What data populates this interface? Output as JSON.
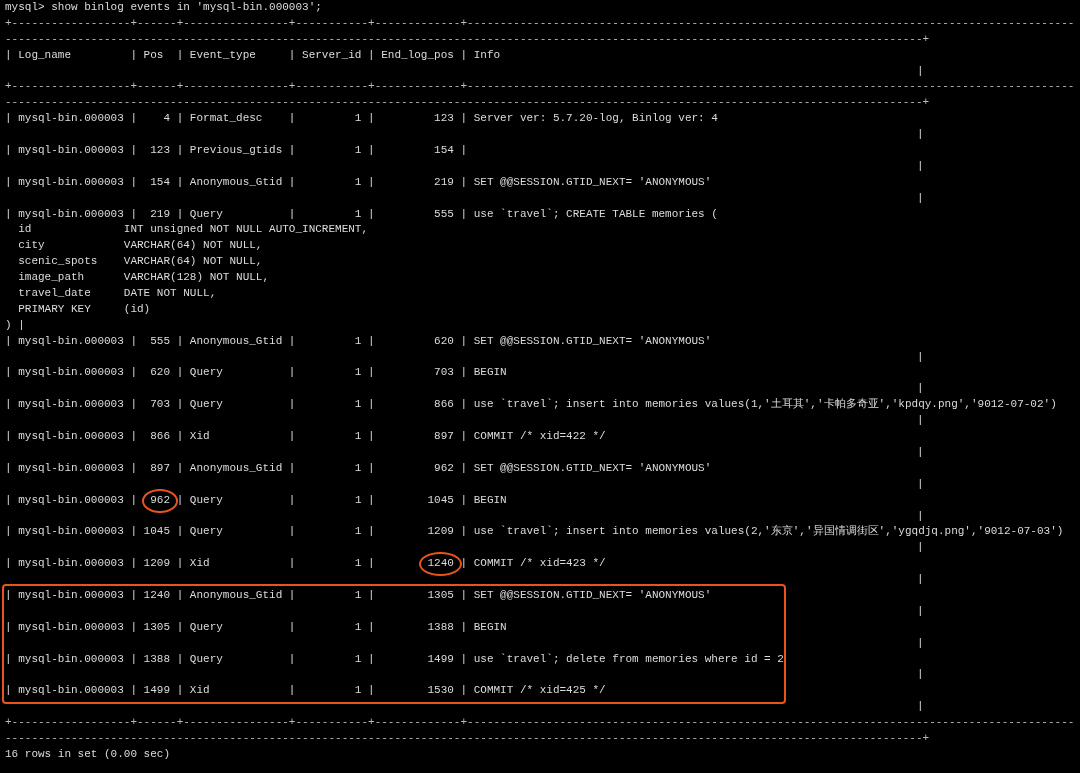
{
  "terminal": {
    "blocks": [
      {
        "boxed": false,
        "lines": [
          {
            "kind": "prompt",
            "text": "mysql> show binlog events in 'mysql-bin.000003';"
          },
          {
            "kind": "border",
            "text": "+------------------+------+----------------+-----------+-------------+--------------------------------------------------------------------------------------------"
          },
          {
            "kind": "border",
            "text": "-------------------------------------------------------------------------------------------------------------------------------------------+"
          },
          {
            "kind": "header",
            "text": "| Log_name         | Pos  | Event_type     | Server_id | End_log_pos | Info"
          },
          {
            "kind": "wrap",
            "text": "|"
          },
          {
            "kind": "border",
            "text": "+------------------+------+----------------+-----------+-------------+--------------------------------------------------------------------------------------------"
          },
          {
            "kind": "border",
            "text": "-------------------------------------------------------------------------------------------------------------------------------------------+"
          },
          {
            "kind": "row",
            "text": "| mysql-bin.000003 |    4 | Format_desc    |         1 |         123 | Server ver: 5.7.20-log, Binlog ver: 4"
          },
          {
            "kind": "wrap",
            "text": "|"
          },
          {
            "kind": "row",
            "text": "| mysql-bin.000003 |  123 | Previous_gtids |         1 |         154 |"
          },
          {
            "kind": "wrap",
            "text": "|"
          },
          {
            "kind": "row",
            "text": "| mysql-bin.000003 |  154 | Anonymous_Gtid |         1 |         219 | SET @@SESSION.GTID_NEXT= 'ANONYMOUS'"
          },
          {
            "kind": "wrap",
            "text": "|"
          },
          {
            "kind": "row",
            "text": "| mysql-bin.000003 |  219 | Query          |         1 |         555 | use `travel`; CREATE TABLE memories ("
          },
          {
            "kind": "row",
            "text": "  id              INT unsigned NOT NULL AUTO_INCREMENT,"
          },
          {
            "kind": "row",
            "text": "  city            VARCHAR(64) NOT NULL,"
          },
          {
            "kind": "row",
            "text": "  scenic_spots    VARCHAR(64) NOT NULL,"
          },
          {
            "kind": "row",
            "text": "  image_path      VARCHAR(128) NOT NULL,"
          },
          {
            "kind": "row",
            "text": "  travel_date     DATE NOT NULL,"
          },
          {
            "kind": "row",
            "text": "  PRIMARY KEY     (id)"
          },
          {
            "kind": "row",
            "text": ") |"
          },
          {
            "kind": "row",
            "text": "| mysql-bin.000003 |  555 | Anonymous_Gtid |         1 |         620 | SET @@SESSION.GTID_NEXT= 'ANONYMOUS'"
          },
          {
            "kind": "wrap",
            "text": "|"
          },
          {
            "kind": "row",
            "text": "| mysql-bin.000003 |  620 | Query          |         1 |         703 | BEGIN"
          },
          {
            "kind": "wrap",
            "text": "|"
          },
          {
            "kind": "row",
            "text": "| mysql-bin.000003 |  703 | Query          |         1 |         866 | use `travel`; insert into memories values(1,'土耳其','卡帕多奇亚','kpdqy.png','9012-07-02')"
          },
          {
            "kind": "wrap",
            "text": "|"
          },
          {
            "kind": "row",
            "text": "| mysql-bin.000003 |  866 | Xid            |         1 |         897 | COMMIT /* xid=422 */"
          },
          {
            "kind": "wrap",
            "text": "|"
          },
          {
            "kind": "row",
            "text": "| mysql-bin.000003 |  897 | Anonymous_Gtid |         1 |         962 | SET @@SESSION.GTID_NEXT= 'ANONYMOUS'"
          },
          {
            "kind": "wrap",
            "text": "|"
          },
          {
            "kind": "marked",
            "parts": [
              {
                "text": "| mysql-bin.000003 |  ",
                "circled": false
              },
              {
                "text": "962",
                "circled": true
              },
              {
                "text": " | Query          |         1 |        1045 | BEGIN",
                "circled": false
              }
            ]
          },
          {
            "kind": "wrap",
            "text": "|"
          },
          {
            "kind": "row",
            "text": "| mysql-bin.000003 | 1045 | Query          |         1 |        1209 | use `travel`; insert into memories values(2,'东京','异国情调街区','ygqdjq.png','9012-07-03')"
          },
          {
            "kind": "wrap",
            "text": "|"
          },
          {
            "kind": "marked",
            "parts": [
              {
                "text": "| mysql-bin.000003 | 1209 | Xid            |         1 |        ",
                "circled": false
              },
              {
                "text": "1240",
                "circled": true
              },
              {
                "text": " | COMMIT /* xid=423 */",
                "circled": false
              }
            ]
          },
          {
            "kind": "wrap",
            "text": "|"
          }
        ]
      },
      {
        "boxed": true,
        "lines": [
          {
            "kind": "row",
            "text": "| mysql-bin.000003 | 1240 | Anonymous_Gtid |         1 |        1305 | SET @@SESSION.GTID_NEXT= 'ANONYMOUS'"
          },
          {
            "kind": "wrap",
            "text": "|"
          },
          {
            "kind": "row",
            "text": "| mysql-bin.000003 | 1305 | Query          |         1 |        1388 | BEGIN"
          },
          {
            "kind": "wrap",
            "text": "|"
          },
          {
            "kind": "row",
            "text": "| mysql-bin.000003 | 1388 | Query          |         1 |        1499 | use `travel`; delete from memories where id = 2"
          },
          {
            "kind": "wrap",
            "text": "|"
          },
          {
            "kind": "row",
            "text": "| mysql-bin.000003 | 1499 | Xid            |         1 |        1530 | COMMIT /* xid=425 */"
          }
        ]
      },
      {
        "boxed": false,
        "lines": [
          {
            "kind": "wrap",
            "text": "|"
          },
          {
            "kind": "border",
            "text": "+------------------+------+----------------+-----------+-------------+--------------------------------------------------------------------------------------------"
          },
          {
            "kind": "border",
            "text": "-------------------------------------------------------------------------------------------------------------------------------------------+"
          },
          {
            "kind": "status",
            "text": "16 rows in set (0.00 sec)"
          }
        ]
      }
    ]
  }
}
